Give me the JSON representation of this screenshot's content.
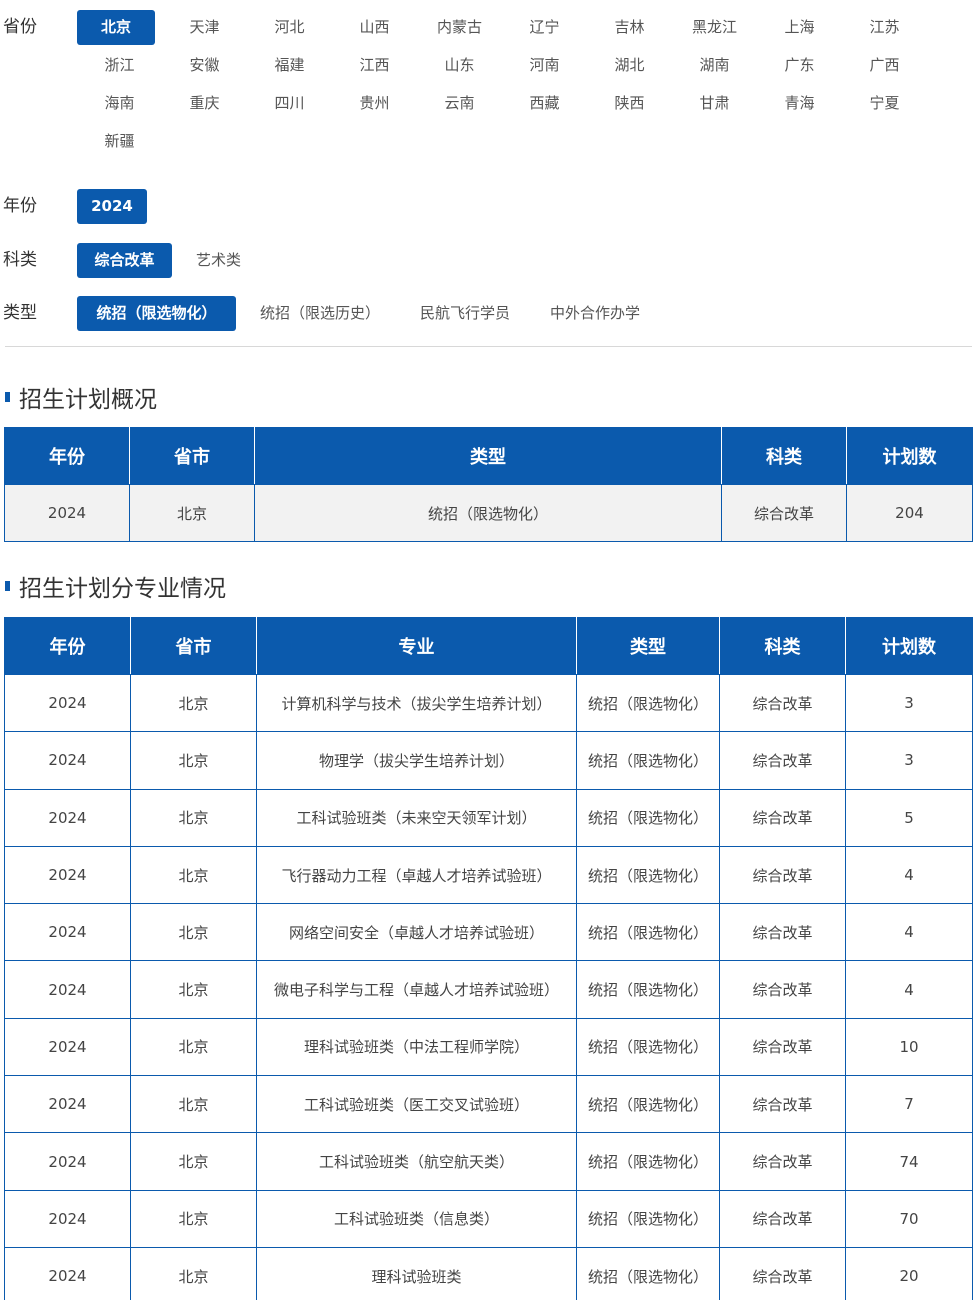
{
  "filters": {
    "province_label": "省份",
    "provinces": [
      "北京",
      "天津",
      "河北",
      "山西",
      "内蒙古",
      "辽宁",
      "吉林",
      "黑龙江",
      "上海",
      "江苏",
      "浙江",
      "安徽",
      "福建",
      "江西",
      "山东",
      "河南",
      "湖北",
      "湖南",
      "广东",
      "广西",
      "海南",
      "重庆",
      "四川",
      "贵州",
      "云南",
      "西藏",
      "陕西",
      "甘肃",
      "青海",
      "宁夏",
      "新疆"
    ],
    "province_selected": "北京",
    "year_label": "年份",
    "year_selected": "2024",
    "kind_label": "科类",
    "kind_selected": "综合改革",
    "kind_other": "艺术类",
    "type_label": "类型",
    "type_selected": "统招（限选物化）",
    "type_others": [
      "统招（限选历史）",
      "民航飞行学员",
      "中外合作办学"
    ]
  },
  "overview": {
    "title": "招生计划概况",
    "headers": [
      "年份",
      "省市",
      "类型",
      "科类",
      "计划数"
    ],
    "row": [
      "2024",
      "北京",
      "统招（限选物化）",
      "综合改革",
      "204"
    ]
  },
  "majors": {
    "title": "招生计划分专业情况",
    "headers": [
      "年份",
      "省市",
      "专业",
      "类型",
      "科类",
      "计划数"
    ],
    "rows": [
      [
        "2024",
        "北京",
        "计算机科学与技术（拔尖学生培养计划）",
        "统招（限选物化）",
        "综合改革",
        "3"
      ],
      [
        "2024",
        "北京",
        "物理学（拔尖学生培养计划）",
        "统招（限选物化）",
        "综合改革",
        "3"
      ],
      [
        "2024",
        "北京",
        "工科试验班类（未来空天领军计划）",
        "统招（限选物化）",
        "综合改革",
        "5"
      ],
      [
        "2024",
        "北京",
        "飞行器动力工程（卓越人才培养试验班）",
        "统招（限选物化）",
        "综合改革",
        "4"
      ],
      [
        "2024",
        "北京",
        "网络空间安全（卓越人才培养试验班）",
        "统招（限选物化）",
        "综合改革",
        "4"
      ],
      [
        "2024",
        "北京",
        "微电子科学与工程（卓越人才培养试验班）",
        "统招（限选物化）",
        "综合改革",
        "4"
      ],
      [
        "2024",
        "北京",
        "理科试验班类（中法工程师学院）",
        "统招（限选物化）",
        "综合改革",
        "10"
      ],
      [
        "2024",
        "北京",
        "工科试验班类（医工交叉试验班）",
        "统招（限选物化）",
        "综合改革",
        "7"
      ],
      [
        "2024",
        "北京",
        "工科试验班类（航空航天类）",
        "统招（限选物化）",
        "综合改革",
        "74"
      ],
      [
        "2024",
        "北京",
        "工科试验班类（信息类）",
        "统招（限选物化）",
        "综合改革",
        "70"
      ],
      [
        "2024",
        "北京",
        "理科试验班类",
        "统招（限选物化）",
        "综合改革",
        "20"
      ]
    ]
  },
  "colors": {
    "accent": "#0b5aad",
    "row_bg": "#f2f2f2"
  }
}
